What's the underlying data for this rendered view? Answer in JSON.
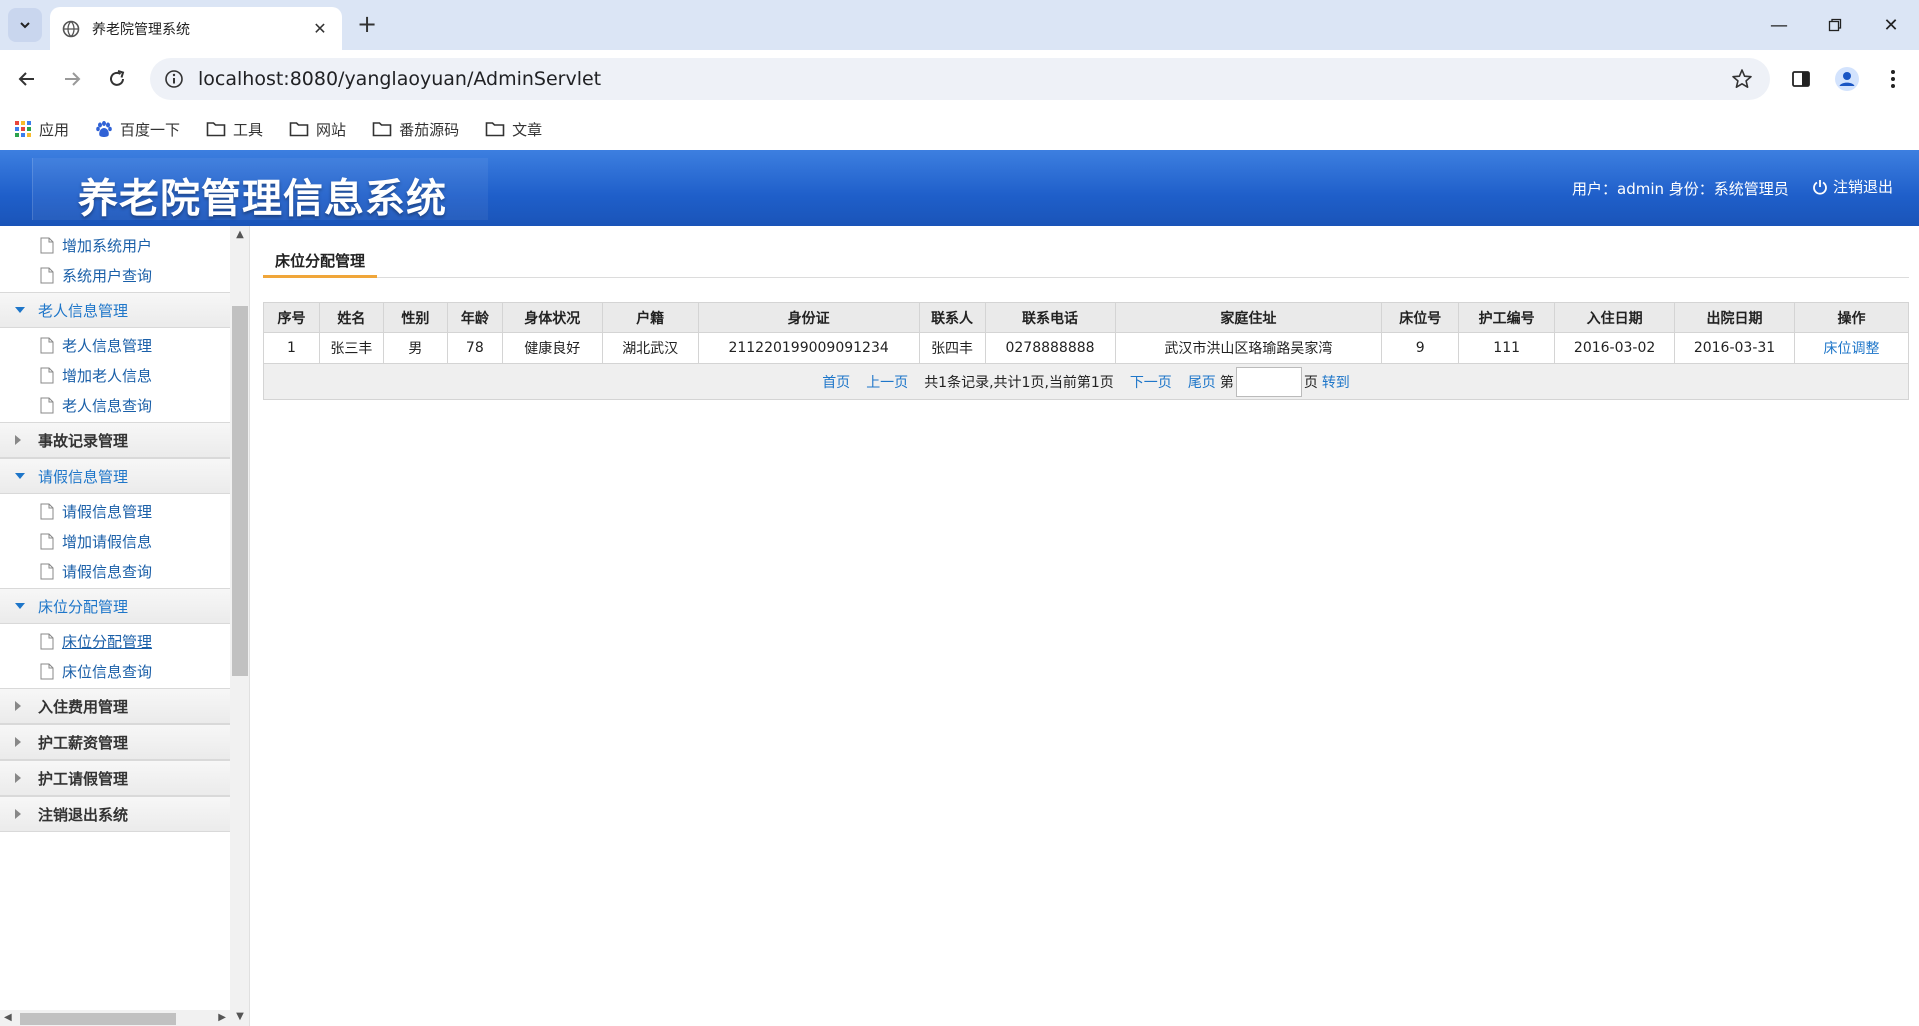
{
  "browser": {
    "tab_title": "养老院管理系统",
    "url": "localhost:8080/yanglaoyuan/AdminServlet",
    "bookmarks": [
      "应用",
      "百度一下",
      "工具",
      "网站",
      "番茄源码",
      "文章"
    ]
  },
  "header": {
    "title": "养老院管理信息系统",
    "user_info": "用户：admin 身份：系统管理员",
    "logout": "注销退出"
  },
  "sidebar": {
    "top_items": [
      "增加系统用户",
      "系统用户查询"
    ],
    "groups": [
      {
        "title": "老人信息管理",
        "open": true,
        "items": [
          "老人信息管理",
          "增加老人信息",
          "老人信息查询"
        ]
      },
      {
        "title": "事故记录管理",
        "open": false,
        "items": []
      },
      {
        "title": "请假信息管理",
        "open": true,
        "items": [
          "请假信息管理",
          "增加请假信息",
          "请假信息查询"
        ]
      },
      {
        "title": "床位分配管理",
        "open": true,
        "items": [
          "床位分配管理",
          "床位信息查询"
        ]
      },
      {
        "title": "入住费用管理",
        "open": false,
        "items": []
      },
      {
        "title": "护工薪资管理",
        "open": false,
        "items": []
      },
      {
        "title": "护工请假管理",
        "open": false,
        "items": []
      },
      {
        "title": "注销退出系统",
        "open": false,
        "items": []
      }
    ]
  },
  "page": {
    "tab_label": "床位分配管理",
    "table": {
      "columns": [
        "序号",
        "姓名",
        "性别",
        "年龄",
        "身体状况",
        "户籍",
        "身份证",
        "联系人",
        "联系电话",
        "家庭住址",
        "床位号",
        "护工编号",
        "入住日期",
        "出院日期",
        "操作"
      ],
      "rows": [
        [
          "1",
          "张三丰",
          "男",
          "78",
          "健康良好",
          "湖北武汉",
          "211220199009091234",
          "张四丰",
          "0278888888",
          "武汉市洪山区珞瑜路吴家湾",
          "9",
          "111",
          "2016-03-02",
          "2016-03-31",
          "床位调整"
        ]
      ]
    },
    "pager": {
      "first": "首页",
      "prev": "上一页",
      "summary": "共1条记录,共计1页,当前第1页",
      "next": "下一页",
      "last": "尾页",
      "page_prefix": "第",
      "page_suffix": "页",
      "go": "转到"
    }
  }
}
